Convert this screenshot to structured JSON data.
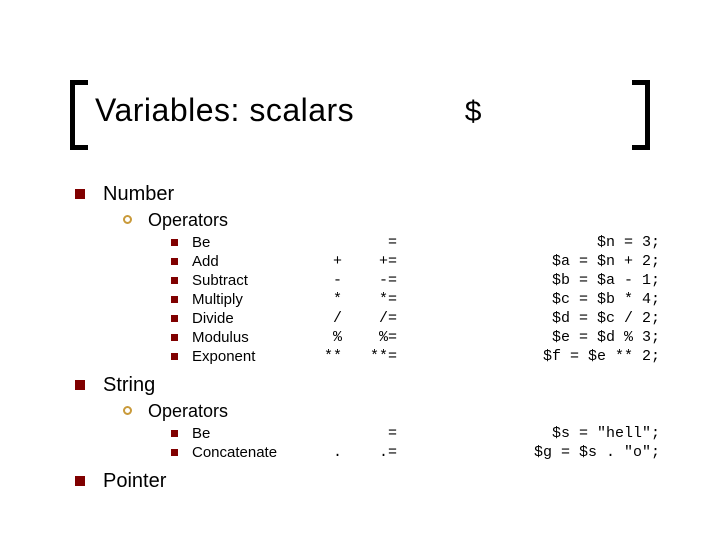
{
  "title": "Variables: scalars",
  "title_symbol": "$",
  "sections": {
    "number": {
      "label": "Number",
      "sub_label": "Operators",
      "ops": [
        {
          "name": "Be",
          "sym": "",
          "asg": "=",
          "ex": "$n = 3;"
        },
        {
          "name": "Add",
          "sym": "+",
          "asg": "+=",
          "ex": "$a = $n + 2;"
        },
        {
          "name": "Subtract",
          "sym": "-",
          "asg": "-=",
          "ex": "$b = $a - 1;"
        },
        {
          "name": "Multiply",
          "sym": "*",
          "asg": "*=",
          "ex": "$c = $b * 4;"
        },
        {
          "name": "Divide",
          "sym": "/",
          "asg": "/=",
          "ex": "$d = $c / 2;"
        },
        {
          "name": "Modulus",
          "sym": "%",
          "asg": "%=",
          "ex": "$e = $d % 3;"
        },
        {
          "name": "Exponent",
          "sym": "**",
          "asg": "**=",
          "ex": "$f = $e ** 2;"
        }
      ]
    },
    "string": {
      "label": "String",
      "sub_label": "Operators",
      "ops": [
        {
          "name": "Be",
          "sym": "",
          "asg": "=",
          "ex": "$s = \"hell\";"
        },
        {
          "name": "Concatenate",
          "sym": ".",
          "asg": ".=",
          "ex": "$g = $s . \"o\";"
        }
      ]
    },
    "pointer": {
      "label": "Pointer"
    }
  }
}
